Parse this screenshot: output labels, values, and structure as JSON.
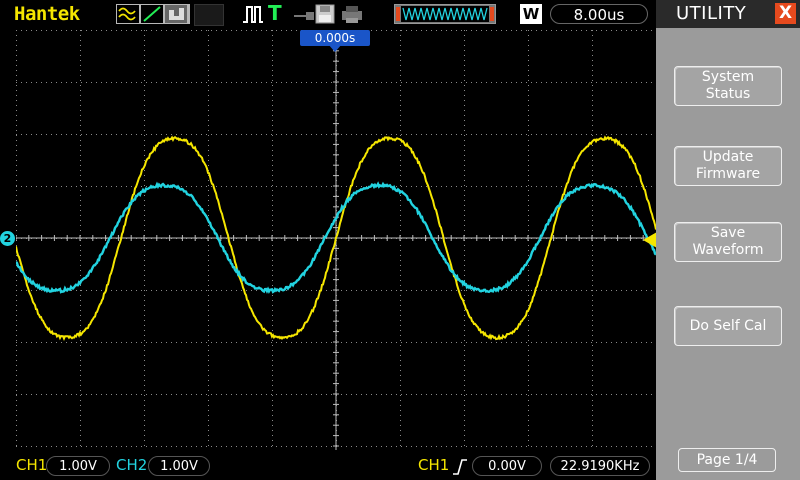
{
  "brand": "Hantek",
  "topbar": {
    "trigger_status": "T",
    "wide_label": "W",
    "timebase": "8.00us"
  },
  "scope": {
    "trigger_position": "0.000s",
    "ch2_marker": "2"
  },
  "bottombar": {
    "ch1_label": "CH1",
    "ch1_scale": "1.00V",
    "ch2_label": "CH2",
    "ch2_scale": "1.00V",
    "trigger_source": "CH1",
    "trigger_level": "0.00V",
    "frequency": "22.9190KHz"
  },
  "menu": {
    "title": "UTILITY",
    "close": "X",
    "buttons": [
      {
        "line1": "System",
        "line2": "Status"
      },
      {
        "line1": "Update",
        "line2": "Firmware"
      },
      {
        "line1": "Save",
        "line2": "Waveform"
      },
      {
        "line1": "Do Self Cal",
        "line2": ""
      }
    ],
    "page": "Page 1/4"
  },
  "colors": {
    "ch1": "#f5e600",
    "ch2": "#22d3e0",
    "grid": "#8a8a8a",
    "menu_bg": "#9b9b9b",
    "close_bg": "#e64a1e",
    "trigger_pos_bg": "#1a55c8"
  }
}
